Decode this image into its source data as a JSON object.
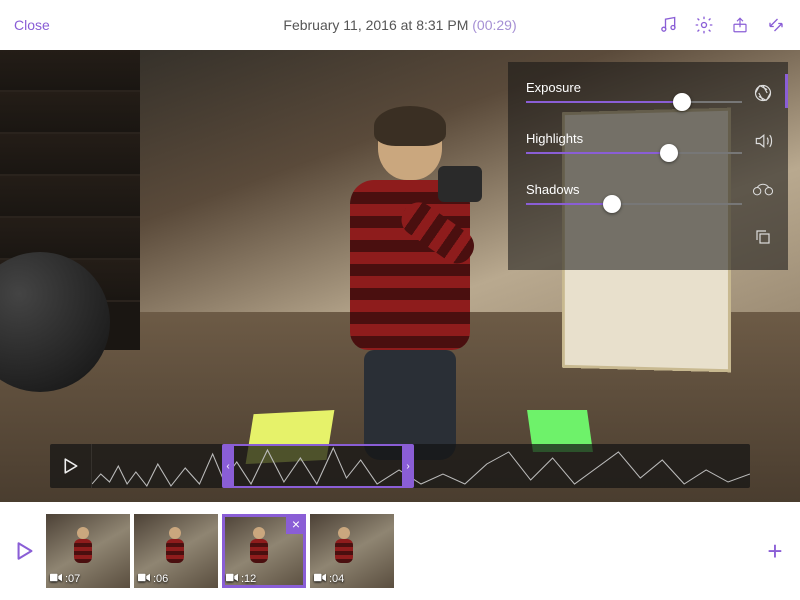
{
  "header": {
    "close_label": "Close",
    "title_date": "February 11, 2016 at 8:31 PM",
    "title_duration": "(00:29)"
  },
  "adjust": {
    "sliders": [
      {
        "label": "Exposure",
        "value": 72
      },
      {
        "label": "Highlights",
        "value": 66
      },
      {
        "label": "Shadows",
        "value": 40
      }
    ]
  },
  "clips": [
    {
      "duration": ":07",
      "selected": false
    },
    {
      "duration": ":06",
      "selected": false
    },
    {
      "duration": ":12",
      "selected": true
    },
    {
      "duration": ":04",
      "selected": false
    }
  ],
  "add_label": "+"
}
